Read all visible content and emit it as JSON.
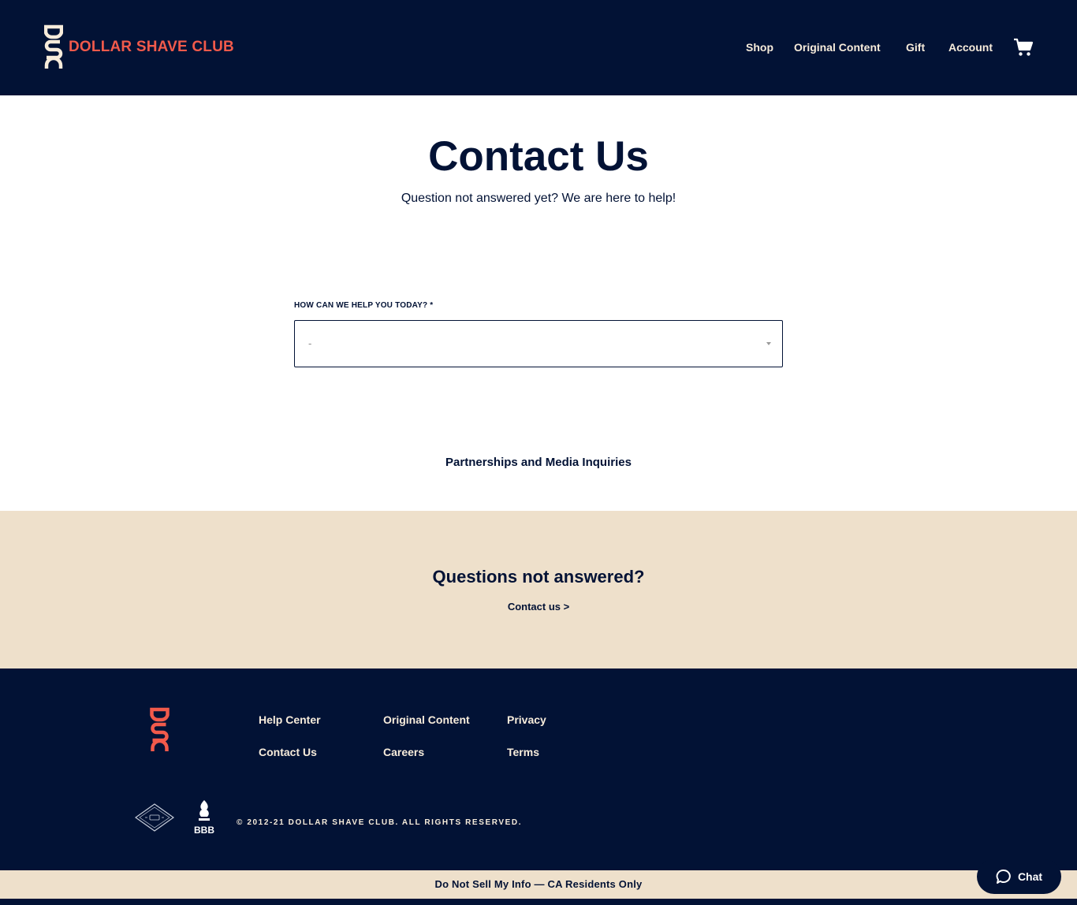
{
  "header": {
    "logo_text": "DOLLAR SHAVE CLUB",
    "logo_mark": "DSC",
    "nav": [
      {
        "label": "Shop"
      },
      {
        "label": "Original Content"
      },
      {
        "label": "Gift"
      },
      {
        "label": "Account"
      }
    ],
    "cart_icon": "cart-icon"
  },
  "main": {
    "title": "Contact Us",
    "subtitle": "Question not answered yet? We are here to help!",
    "help_field": {
      "label": "HOW CAN WE HELP YOU TODAY? *",
      "value": "-"
    },
    "partners_link": "Partnerships and Media Inquiries"
  },
  "questions": {
    "heading": "Questions not answered?",
    "link": "Contact us >"
  },
  "footer": {
    "mark": "DSC",
    "links": [
      {
        "label": "Help Center"
      },
      {
        "label": "Contact Us"
      },
      {
        "label": "Original Content"
      },
      {
        "label": "Careers"
      },
      {
        "label": "Privacy"
      },
      {
        "label": "Terms"
      }
    ],
    "badge_text": "BBB",
    "copyright": "© 2012-21 DOLLAR SHAVE CLUB. ALL RIGHTS RESERVED."
  },
  "ccpa": {
    "text": "Do Not Sell My Info — CA Residents Only"
  },
  "chat": {
    "label": "Chat",
    "icon": "chat-bubble-icon"
  },
  "colors": {
    "navy": "#021235",
    "coral": "#f15a4b",
    "cream": "#eee0cb",
    "cream_text": "#f7ecdb"
  }
}
